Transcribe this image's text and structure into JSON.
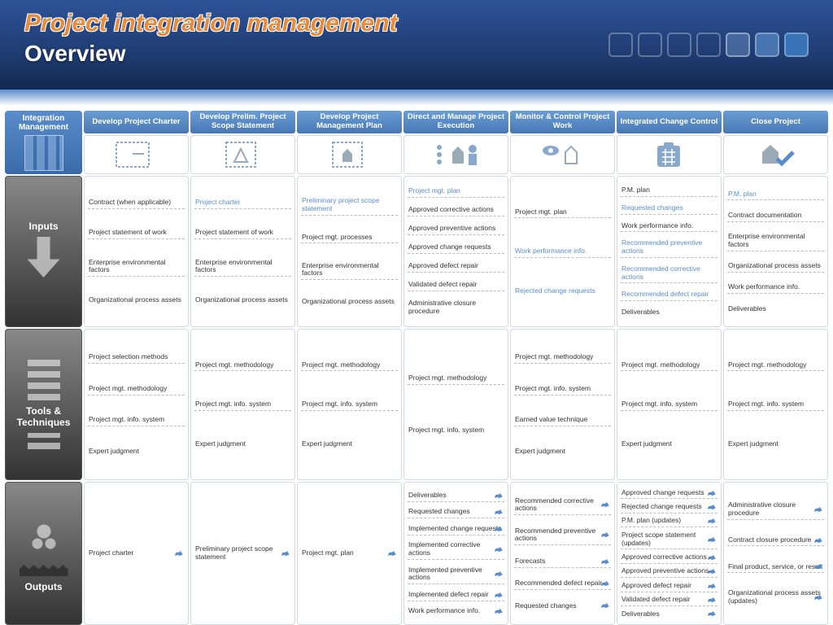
{
  "header": {
    "title": "Project integration management",
    "subtitle": "Overview"
  },
  "corner_label": "Integration Management",
  "row_labels": [
    "Inputs",
    "Tools & Techniques",
    "Outputs"
  ],
  "columns": [
    "Develop Project Charter",
    "Develop Prelim. Project Scope Statement",
    "Develop Project Management Plan",
    "Direct and Manage Project Execution",
    "Monitor & Control Project Work",
    "Integrated Change Control",
    "Close Project"
  ],
  "data": [
    {
      "inputs": [
        {
          "t": "Contract (when applicable)"
        },
        {
          "t": "Project statement of work"
        },
        {
          "t": "Enterprise environmental factors"
        },
        {
          "t": "Organizational process assets"
        }
      ],
      "tools": [
        {
          "t": "Project selection methods"
        },
        {
          "t": "Project mgt. methodology"
        },
        {
          "t": "Project mgt. info. system"
        },
        {
          "t": "Expert judgment"
        }
      ],
      "outputs": [
        {
          "t": "Project charter",
          "p": true
        }
      ]
    },
    {
      "inputs": [
        {
          "t": "Project charter",
          "r": true
        },
        {
          "t": "Project statement of work"
        },
        {
          "t": "Enterprise environmental factors"
        },
        {
          "t": "Organizational process assets"
        }
      ],
      "tools": [
        {
          "t": "Project mgt. methodology"
        },
        {
          "t": "Project mgt. info. system"
        },
        {
          "t": "Expert judgment"
        }
      ],
      "outputs": [
        {
          "t": "Preliminary project scope statement",
          "p": true
        }
      ]
    },
    {
      "inputs": [
        {
          "t": "Preliminary project scope statement",
          "r": true
        },
        {
          "t": "Project mgt. processes"
        },
        {
          "t": "Enterprise environmental factors"
        },
        {
          "t": "Organizational process assets"
        }
      ],
      "tools": [
        {
          "t": "Project mgt. methodology"
        },
        {
          "t": "Project mgt. info. system"
        },
        {
          "t": "Expert judgment"
        }
      ],
      "outputs": [
        {
          "t": "Project mgt. plan",
          "p": true
        }
      ]
    },
    {
      "inputs": [
        {
          "t": "Project mgt. plan",
          "r": true
        },
        {
          "t": "Approved corrective actions"
        },
        {
          "t": "Approved preventive actions"
        },
        {
          "t": "Approved change requests"
        },
        {
          "t": "Approved defect repair"
        },
        {
          "t": "Validated defect repair"
        },
        {
          "t": "Administrative closure procedure"
        }
      ],
      "tools": [
        {
          "t": "Project mgt. methodology"
        },
        {
          "t": "Project mgt. info. system"
        }
      ],
      "outputs": [
        {
          "t": "Deliverables",
          "p": true
        },
        {
          "t": "Requested changes",
          "p": true
        },
        {
          "t": "Implemented change requests",
          "p": true
        },
        {
          "t": "Implemented corrective actions",
          "p": true
        },
        {
          "t": "Implemented preventive actions",
          "p": true
        },
        {
          "t": "Implemented defect repair",
          "p": true
        },
        {
          "t": "Work performance info.",
          "p": true
        }
      ]
    },
    {
      "inputs": [
        {
          "t": "Project mgt. plan"
        },
        {
          "t": "Work performance info.",
          "r": true
        },
        {
          "t": "Rejected change requests",
          "r": true
        }
      ],
      "tools": [
        {
          "t": "Project mgt. methodology"
        },
        {
          "t": "Project mgt. info. system"
        },
        {
          "t": "Earned value technique"
        },
        {
          "t": "Expert judgment"
        }
      ],
      "outputs": [
        {
          "t": "Recommended corrective actions",
          "p": true
        },
        {
          "t": "Recommended preventive actions",
          "p": true
        },
        {
          "t": "Forecasts",
          "p": true
        },
        {
          "t": "Recommended defect repair",
          "p": true
        },
        {
          "t": "Requested changes",
          "p": true
        }
      ]
    },
    {
      "inputs": [
        {
          "t": "P.M. plan"
        },
        {
          "t": "Requested changes",
          "r": true
        },
        {
          "t": "Work performance info."
        },
        {
          "t": "Recommended preventive actions",
          "r": true
        },
        {
          "t": "Recommended corrective actions",
          "r": true
        },
        {
          "t": "Recommended defect repair",
          "r": true
        },
        {
          "t": "Deliverables"
        }
      ],
      "tools": [
        {
          "t": "Project mgt. methodology"
        },
        {
          "t": "Project mgt. info. system"
        },
        {
          "t": "Expert judgment"
        }
      ],
      "outputs": [
        {
          "t": "Approved change requests",
          "p": true
        },
        {
          "t": "Rejected change requests",
          "p": true
        },
        {
          "t": "P.M. plan (updates)",
          "p": true
        },
        {
          "t": "Project scope statement (updates)",
          "p": true
        },
        {
          "t": "Approved corrective actions",
          "p": true
        },
        {
          "t": "Approved preventive actions",
          "p": true
        },
        {
          "t": "Approved defect repair",
          "p": true
        },
        {
          "t": "Validated defect repair",
          "p": true
        },
        {
          "t": "Deliverables",
          "p": true
        }
      ]
    },
    {
      "inputs": [
        {
          "t": "P.M. plan",
          "r": true
        },
        {
          "t": "Contract documentation"
        },
        {
          "t": "Enterprise environmental factors"
        },
        {
          "t": "Organizational process assets"
        },
        {
          "t": "Work performance info."
        },
        {
          "t": "Deliverables"
        }
      ],
      "tools": [
        {
          "t": "Project mgt. methodology"
        },
        {
          "t": "Project mgt. info. system"
        },
        {
          "t": "Expert judgment"
        }
      ],
      "outputs": [
        {
          "t": "Administrative closure procedure",
          "p": true
        },
        {
          "t": "Contract closure procedure",
          "p": true
        },
        {
          "t": "Final product, service, or result",
          "p": true
        },
        {
          "t": "Organizational process assets (updates)",
          "p": true
        }
      ]
    }
  ]
}
